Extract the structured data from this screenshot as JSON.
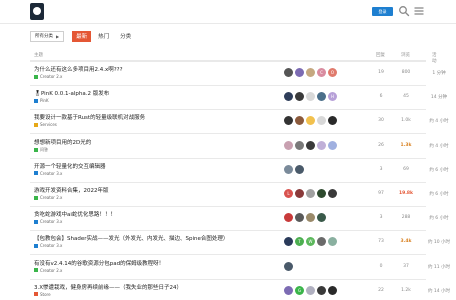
{
  "header": {
    "login_label": "登录",
    "login_color": "#1e7fd0",
    "search_icon": "search-icon",
    "menu_icon": "hamburger-icon"
  },
  "nav": {
    "category_select": "所有分类",
    "tabs": [
      {
        "label": "最新",
        "active": true
      },
      {
        "label": "热门",
        "active": false
      },
      {
        "label": "分类",
        "active": false
      }
    ],
    "accent": "#e45735"
  },
  "table": {
    "headers": {
      "topic": "主题",
      "replies": "回复",
      "views": "浏览",
      "activity": "活动"
    },
    "rows": [
      {
        "title": "为什么还有这么多项目用2.4.x啊???",
        "category": "Creator 2.x",
        "cat_color": "#3ab54a",
        "replies": "19",
        "views": "800",
        "views_style": "",
        "activity": "1 分钟",
        "avatars": [
          {
            "letter": "",
            "color": "#555555"
          },
          {
            "letter": "",
            "color": "#7c6bb3"
          },
          {
            "letter": "",
            "color": "#c5a880"
          },
          {
            "letter": "C",
            "color": "#d98ca0"
          },
          {
            "letter": "O",
            "color": "#e07a6c"
          }
        ]
      },
      {
        "title": "🎖PinK 0.0.1-alpha.2 版发布",
        "category": "PinK",
        "cat_color": "#1e7fd0",
        "replies": "6",
        "views": "45",
        "views_style": "",
        "activity": "14 分钟",
        "avatars": [
          {
            "letter": "",
            "color": "#2f3e5a"
          },
          {
            "letter": "",
            "color": "#3b3b3b"
          },
          {
            "letter": "",
            "color": "#d9d9d9"
          },
          {
            "letter": "",
            "color": "#4b6f8a"
          },
          {
            "letter": "H",
            "color": "#b7a0d8"
          }
        ]
      },
      {
        "title": "我要设计一款基于Rust的轻量级联机对战服务",
        "category": "Services",
        "cat_color": "#e6a817",
        "replies": "30",
        "views": "1.0k",
        "views_style": "",
        "activity": "约 4 小时",
        "avatars": [
          {
            "letter": "",
            "color": "#333333"
          },
          {
            "letter": "",
            "color": "#8b5a3c"
          },
          {
            "letter": "",
            "color": "#f2c14e"
          },
          {
            "letter": "",
            "color": "#d8d8d8"
          },
          {
            "letter": "",
            "color": "#2a2a2a"
          }
        ]
      },
      {
        "title": "想想新项目用的2D光的",
        "category": "问答",
        "cat_color": "#3ab54a",
        "replies": "26",
        "views": "1.3k",
        "views_style": "warm",
        "activity": "约 4 小时",
        "avatars": [
          {
            "letter": "",
            "color": "#c8a0b0"
          },
          {
            "letter": "",
            "color": "#7a7a7a"
          },
          {
            "letter": "",
            "color": "#3a3a3a"
          },
          {
            "letter": "",
            "color": "#c0b0d8"
          },
          {
            "letter": "",
            "color": "#a0b0e0"
          }
        ]
      },
      {
        "title": "开源一个轻量化的交互编辑器",
        "category": "Creator 3.x",
        "cat_color": "#1e7fd0",
        "replies": "3",
        "views": "69",
        "views_style": "",
        "activity": "约 6 小时",
        "avatars": [
          {
            "letter": "",
            "color": "#7a8a9a"
          },
          {
            "letter": "",
            "color": "#4a5a6a"
          }
        ]
      },
      {
        "title": "游戏开发资料合集，2022年版",
        "category": "Creator 2.x",
        "cat_color": "#3ab54a",
        "replies": "97",
        "views": "19.8k",
        "views_style": "hot",
        "activity": "约 6 小时",
        "avatars": [
          {
            "letter": "L",
            "color": "#d9534f"
          },
          {
            "letter": "",
            "color": "#8a3a3a"
          },
          {
            "letter": "",
            "color": "#a0a0a0"
          },
          {
            "letter": "",
            "color": "#2e4a2e"
          },
          {
            "letter": "",
            "color": "#3a3a3a"
          }
        ]
      },
      {
        "title": "贪吃蛇游戏中ai蛇优化思路！！！",
        "category": "Creator 3.x",
        "cat_color": "#1e7fd0",
        "replies": "3",
        "views": "288",
        "views_style": "",
        "activity": "约 6 小时",
        "avatars": [
          {
            "letter": "",
            "color": "#c83a3a"
          },
          {
            "letter": "",
            "color": "#5a5a5a"
          },
          {
            "letter": "",
            "color": "#9a8a6a"
          },
          {
            "letter": "",
            "color": "#3a5a4a"
          }
        ]
      },
      {
        "title": "【包教包会】Shader实战——发光（外发光、内发光、描边、Spine合图处理）",
        "category": "Creator 3.x",
        "cat_color": "#1e7fd0",
        "replies": "73",
        "views": "3.4k",
        "views_style": "warm",
        "activity": "约 10 小时",
        "avatars": [
          {
            "letter": "",
            "color": "#2a3a5a"
          },
          {
            "letter": "T",
            "color": "#4caf50"
          },
          {
            "letter": "W",
            "color": "#5cb85c"
          },
          {
            "letter": "",
            "color": "#6a6a6a"
          },
          {
            "letter": "",
            "color": "#8ab0a0"
          }
        ]
      },
      {
        "title": "有没有v2.4.14的谷歌资源分包pad的保姆级教程呀！",
        "category": "Creator 2.x",
        "cat_color": "#3ab54a",
        "replies": "0",
        "views": "37",
        "views_style": "",
        "activity": "约 11 小时",
        "avatars": [
          {
            "letter": "",
            "color": "#4a5a6a"
          }
        ]
      },
      {
        "title": "3.X惨遭栽戏，健身房再续前缘——（我失业的那些日子24）",
        "category": "Store",
        "cat_color": "#e45735",
        "replies": "22",
        "views": "1.2k",
        "views_style": "",
        "activity": "约 14 小时",
        "avatars": [
          {
            "letter": "",
            "color": "#7c6bb3"
          },
          {
            "letter": "G",
            "color": "#3ab54a"
          },
          {
            "letter": "",
            "color": "#b0b0c0"
          },
          {
            "letter": "",
            "color": "#3a3a3a"
          },
          {
            "letter": "",
            "color": "#2a2a2a"
          }
        ]
      }
    ]
  }
}
